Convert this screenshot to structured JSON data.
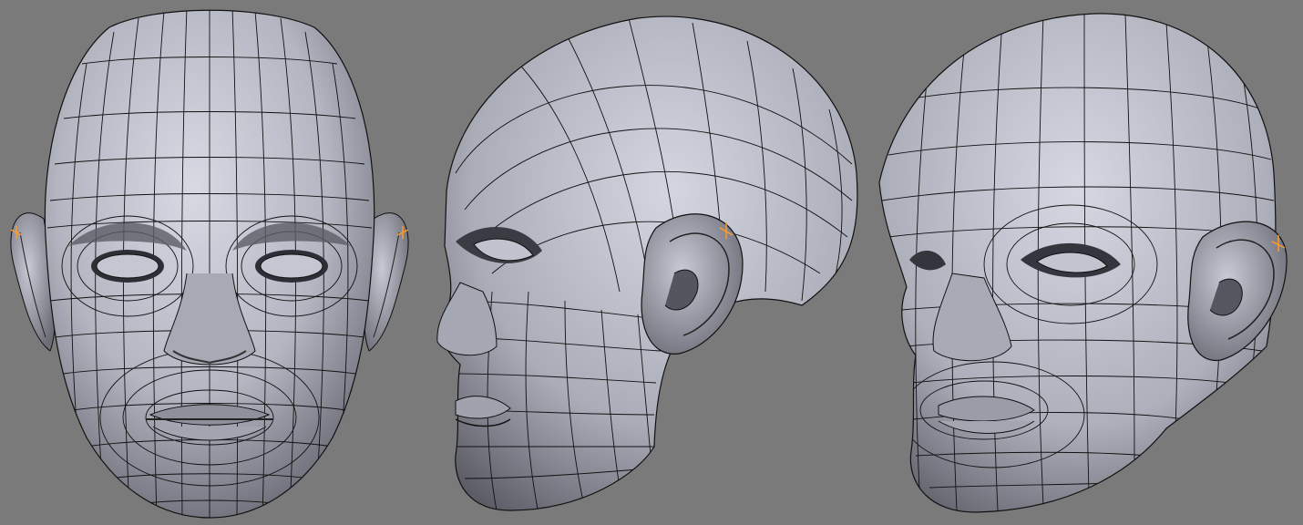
{
  "scene": {
    "background_color": "#7a7a7a",
    "mesh_fill_light": "#c9cbd6",
    "mesh_fill_mid": "#9fa1ad",
    "mesh_fill_dark": "#4b4c55",
    "wire_color": "#111111",
    "vertex_highlight_color": "#ff9a2a",
    "views": [
      {
        "name": "front"
      },
      {
        "name": "side"
      },
      {
        "name": "three-quarter"
      }
    ]
  }
}
